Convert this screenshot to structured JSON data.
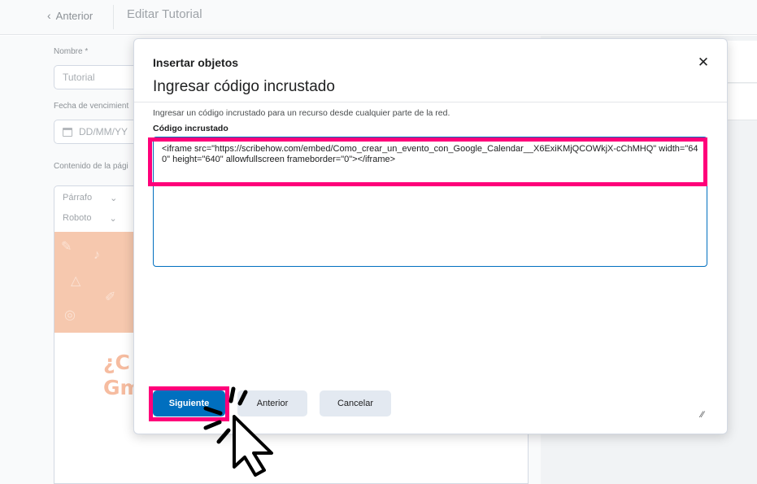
{
  "topbar": {
    "back_label": "Anterior",
    "page_title": "Editar Tutorial"
  },
  "form": {
    "name_label": "Nombre *",
    "name_value": "Tutorial",
    "due_date_label": "Fecha de vencimient",
    "due_date_placeholder": "DD/MM/YY",
    "content_label": "Contenido de la pági",
    "editor_style": "Párrafo",
    "editor_font": "Roboto",
    "editor_heading_text": [
      "¿C",
      "Gm"
    ]
  },
  "modal": {
    "title": "Insertar objetos",
    "subtitle": "Ingresar código incrustado",
    "description": "Ingresar un código incrustado para un recurso desde cualquier parte de la red.",
    "code_label": "Código incrustado",
    "code_value": "<iframe src=\"https://scribehow.com/embed/Como_crear_un_evento_con_Google_Calendar__X6ExiKMjQCOWkjX-cChMHQ\" width=\"640\" height=\"640\" allowfullscreen frameborder=\"0\"></iframe>",
    "buttons": {
      "next": "Siguiente",
      "back": "Anterior",
      "cancel": "Cancelar"
    }
  },
  "icons": {
    "close": "close-icon",
    "back": "chevron-left-icon",
    "calendar": "calendar-icon",
    "resize": "resize-handle-icon",
    "cursor": "click-cursor-icon"
  },
  "colors": {
    "highlight": "#ff007a",
    "primary": "#006fbf",
    "secondary_button": "#e3e9f1"
  }
}
